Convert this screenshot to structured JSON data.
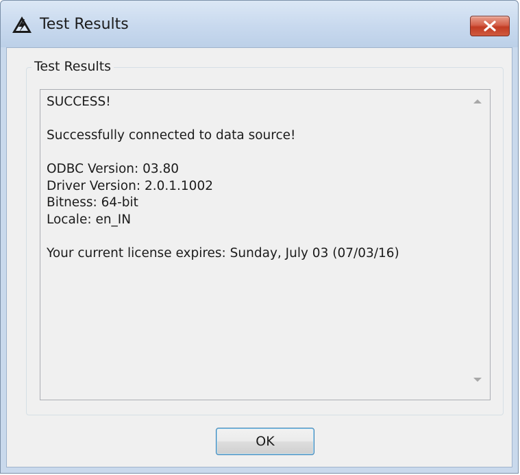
{
  "window": {
    "title": "Test Results",
    "app_icon": "warning-triangle-icon",
    "close_icon": "close-icon"
  },
  "group": {
    "label": "Test Results"
  },
  "results": {
    "lines": [
      "SUCCESS!",
      "",
      "Successfully connected to data source!",
      "",
      "ODBC Version: 03.80",
      "Driver Version: 2.0.1.1002",
      "Bitness: 64-bit",
      "Locale: en_IN",
      "",
      "Your current license expires: Sunday, July 03 (07/03/16)"
    ]
  },
  "buttons": {
    "ok_label": "OK"
  },
  "colors": {
    "titlebar": "#c8d9ee",
    "close_button": "#c94a32",
    "client_background": "#f0f0f0",
    "ok_border": "#3c7fb1"
  }
}
